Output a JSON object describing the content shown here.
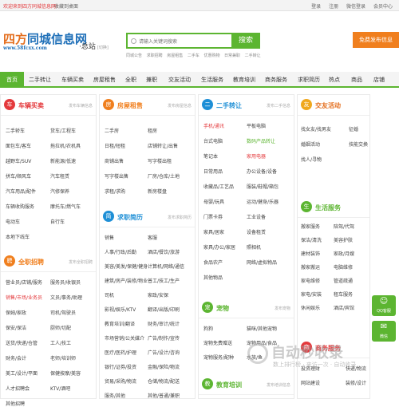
{
  "topbar": {
    "welcome": "欢迎来到四方同城信息网！",
    "favorite": "收藏到桌面",
    "links": [
      "登录",
      "注册",
      "微信登录",
      "会员中心"
    ]
  },
  "logo": {
    "main_a": "四方",
    "main_b": "同城信息网",
    "url": "www.58fcxx.com"
  },
  "city": {
    "name": "·总站",
    "switch": "[切换]"
  },
  "search": {
    "placeholder": "请输入关键词搜索",
    "button": "搜索",
    "hot": [
      "同城公告",
      "求职招聘",
      "房屋租售",
      "二手车",
      "优惠购物",
      "日常兼职",
      "二手转让"
    ]
  },
  "post_button": "免费发布信息",
  "nav": [
    {
      "label": "首页",
      "active": true
    },
    {
      "label": "二手转让"
    },
    {
      "label": "车辆买卖"
    },
    {
      "label": "房屋租售"
    },
    {
      "label": "全职"
    },
    {
      "label": "兼职"
    },
    {
      "label": "交友活动"
    },
    {
      "label": "生活服务"
    },
    {
      "label": "教育培训"
    },
    {
      "label": "商务服务"
    },
    {
      "label": "求职简历"
    },
    {
      "label": "热点"
    },
    {
      "label": "商品"
    },
    {
      "label": "店铺"
    }
  ],
  "sections": {
    "cars": {
      "title": "车辆买卖",
      "more": "发布车辆信息",
      "items": [
        "二手轿车",
        "货车/工程车",
        "面包车/客车",
        "拖拉机/农机具",
        "越野车/SUV",
        "新能源/低速",
        "拼车/顺风车",
        "汽车租赁",
        "汽车用品/配件",
        "汽修保养",
        "车辆收购服务",
        "摩托车/燃气车",
        "电动车",
        "自行车",
        "本地下线车"
      ]
    },
    "jobs": {
      "title": "全职招聘",
      "more": "发布全职招聘",
      "items": [
        "营业员/店铺/服务",
        "服务员/收银员",
        "销售/市场/业务员",
        "文员/事务/助理",
        "保姆/家政",
        "司机/驾驶员",
        "保安/保洁",
        "厨师/切配",
        "送货/快递/仓管",
        "工人/技工",
        "财务/会计",
        "老师/培训师",
        "美工/设计/平面",
        "保健按摩/美容",
        "人才招聘会",
        "KTV/酒吧",
        "其他招聘"
      ]
    },
    "house": {
      "title": "房屋租售",
      "more": "发布房屋信息",
      "items": [
        "二手房",
        "租房",
        "日租/短租",
        "店铺转让/出售",
        "商铺出售",
        "写字楼出租",
        "写字楼出售",
        "厂房/仓库/土地",
        "求租/求购",
        "新房楼盘"
      ]
    },
    "resume": {
      "title": "求职简历",
      "more": "发布求职简历",
      "items": [
        "销售",
        "客服",
        "人事/行政/后勤",
        "酒店/餐饮/旅游",
        "美容/美发/保健/健身",
        "计算机/网络/通信",
        "建筑/房产/装修/物业",
        "普工/技工/生产",
        "司机",
        "家政/安保",
        "影视/娱乐/KTV",
        "翻译/出版/印刷",
        "教育培训/翻译",
        "财务/审计/统计",
        "市场营销/公关媒介",
        "广告/制作/宣传",
        "医疗/医药/护理",
        "广告/设计/咨询",
        "银行/证券/投资",
        "金融/保险/物流",
        "贸易/采购/物流",
        "仓储/物流/配送",
        "服务/其他",
        "其他/普通/兼职"
      ]
    },
    "used": {
      "title": "二手转让",
      "more": "发布二手信息",
      "items": [
        "手机/通讯",
        "平板电脑",
        "台式电脑",
        "数码产品转让",
        "笔记本",
        "家用电器",
        "日常用品",
        "办公设备/设备",
        "收藏品/工艺品",
        "服装/鞋帽/箱包",
        "母婴/玩具",
        "运动/健身/乐器",
        "门票卡券",
        "工业设备",
        "家具/居家",
        "设备租赁",
        "家具/办公/家居",
        "照相机",
        "食品农产",
        "网络/虚拟物品",
        "其他物品"
      ]
    },
    "pets": {
      "title": "宠物",
      "more": "发布宠物",
      "items": [
        "狗狗",
        "猫咪/其他宠物",
        "宠物免费赠送",
        "宠物用品/食品",
        "宠物服务/配种",
        "水族/鱼"
      ]
    },
    "edu": {
      "title": "教育培训",
      "more": "发布培训信息"
    },
    "dating": {
      "title": "交友活动",
      "more": "发布交友信息",
      "items": [
        "找女友/找男友",
        "征婚",
        "婚姻活动",
        "技能交换",
        "找人/寻物"
      ]
    },
    "life": {
      "title": "生活服务",
      "more": "",
      "items": [
        "搬家服务",
        "陪驾/代驾",
        "婚庆/礼仪",
        "保洁/清洗",
        "美容护肤",
        "美甲美睫",
        "建材装饰",
        "家政/月嫂",
        "电脑维修",
        "搬家搬运",
        "空调维修",
        "家电维修",
        "管道疏通",
        "开锁换锁",
        "家电/安装",
        "租车服务",
        "休闲娱乐",
        "酒店/宾馆"
      ]
    },
    "biz": {
      "title": "商务服务",
      "more": "",
      "items": [
        "投资理财",
        "快递/物流",
        "网站建设",
        "装修/设计"
      ]
    }
  },
  "side": {
    "qq": "QQ客服",
    "wechat": "微信"
  },
  "watermark": {
    "title": "自动秒收录",
    "sub": "数上排行榜 · 来访一次 · 自动收录"
  }
}
